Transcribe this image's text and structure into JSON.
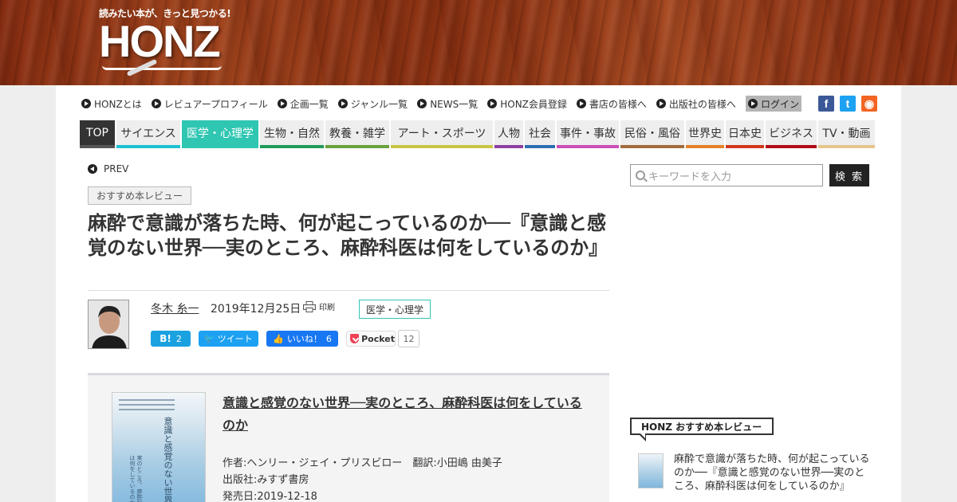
{
  "logo": {
    "tagline": "読みたい本が、きっと見つかる!",
    "wordmark": "HONZ"
  },
  "top_links": [
    {
      "label": "HONZとは"
    },
    {
      "label": "レビュアープロフィール"
    },
    {
      "label": "企画一覧"
    },
    {
      "label": "ジャンル一覧"
    },
    {
      "label": "NEWS一覧"
    },
    {
      "label": "HONZ会員登録"
    },
    {
      "label": "書店の皆様へ"
    },
    {
      "label": "出版社の皆様へ"
    },
    {
      "label": "ログイン"
    }
  ],
  "social": [
    {
      "icon": "facebook-icon",
      "glyph": "f",
      "color": "#3b5998"
    },
    {
      "icon": "twitter-icon",
      "glyph": "t",
      "color": "#1da1f2"
    },
    {
      "icon": "rss-icon",
      "glyph": "◉",
      "color": "#f26522"
    }
  ],
  "categories": [
    {
      "label": "TOP",
      "color": "#555555"
    },
    {
      "label": "サイエンス",
      "color": "#1ec1d2"
    },
    {
      "label": "医学・心理学",
      "color": "#2fc6b2",
      "active": true
    },
    {
      "label": "生物・自然",
      "color": "#1f9a5a"
    },
    {
      "label": "教養・雑学",
      "color": "#6aa03c"
    },
    {
      "label": "アート・スポーツ",
      "color": "#c8c645"
    },
    {
      "label": "人物",
      "color": "#8e3fa0"
    },
    {
      "label": "社会",
      "color": "#2d6fb2"
    },
    {
      "label": "事件・事故",
      "color": "#c94fb7"
    },
    {
      "label": "民俗・風俗",
      "color": "#a26b3c"
    },
    {
      "label": "世界史",
      "color": "#e5812a"
    },
    {
      "label": "日本史",
      "color": "#d0381c"
    },
    {
      "label": "ビジネス",
      "color": "#b10c16"
    },
    {
      "label": "TV・動画",
      "color": "#e4c68c"
    }
  ],
  "article": {
    "prev_label": "PREV",
    "category_tag": "おすすめ本レビュー",
    "title": "麻酔で意識が落ちた時、何が起こっているのか──『意識と感覚のない世界──実のところ、麻酔科医は何をしているのか』",
    "author": "冬木 糸一",
    "date": "2019年12月25日",
    "print_label": "印刷",
    "genre_tag": "医学・心理学",
    "share": {
      "hatena_label": "B!",
      "hatena_count": "2",
      "tweet_label": "ツイート",
      "like_label": "いいね！",
      "like_count": "6",
      "pocket_label": "Pocket",
      "pocket_count": "12"
    }
  },
  "book": {
    "title": "意識と感覚のない世界──実のところ、麻酔科医は何をしているのか",
    "author": "作者:ヘンリー・ジェイ・プリスビロー　翻訳:小田嶋 由美子",
    "publisher": "出版社:みすず書房",
    "release_date": "発売日:2019-12-18",
    "cover_title": "意識と感覚のない世界",
    "cover_subtitle": "実のところ、麻酔科医は何をしているのか"
  },
  "sidebar": {
    "search_placeholder": "キーワードを入力",
    "search_button": "検 索",
    "section_label": "HONZ おすすめ本レビュー",
    "item_text": "麻酔で意識が落ちた時、何が起こっているのか──『意識と感覚のない世界──実のところ、麻酔科医は何をしているのか』"
  }
}
